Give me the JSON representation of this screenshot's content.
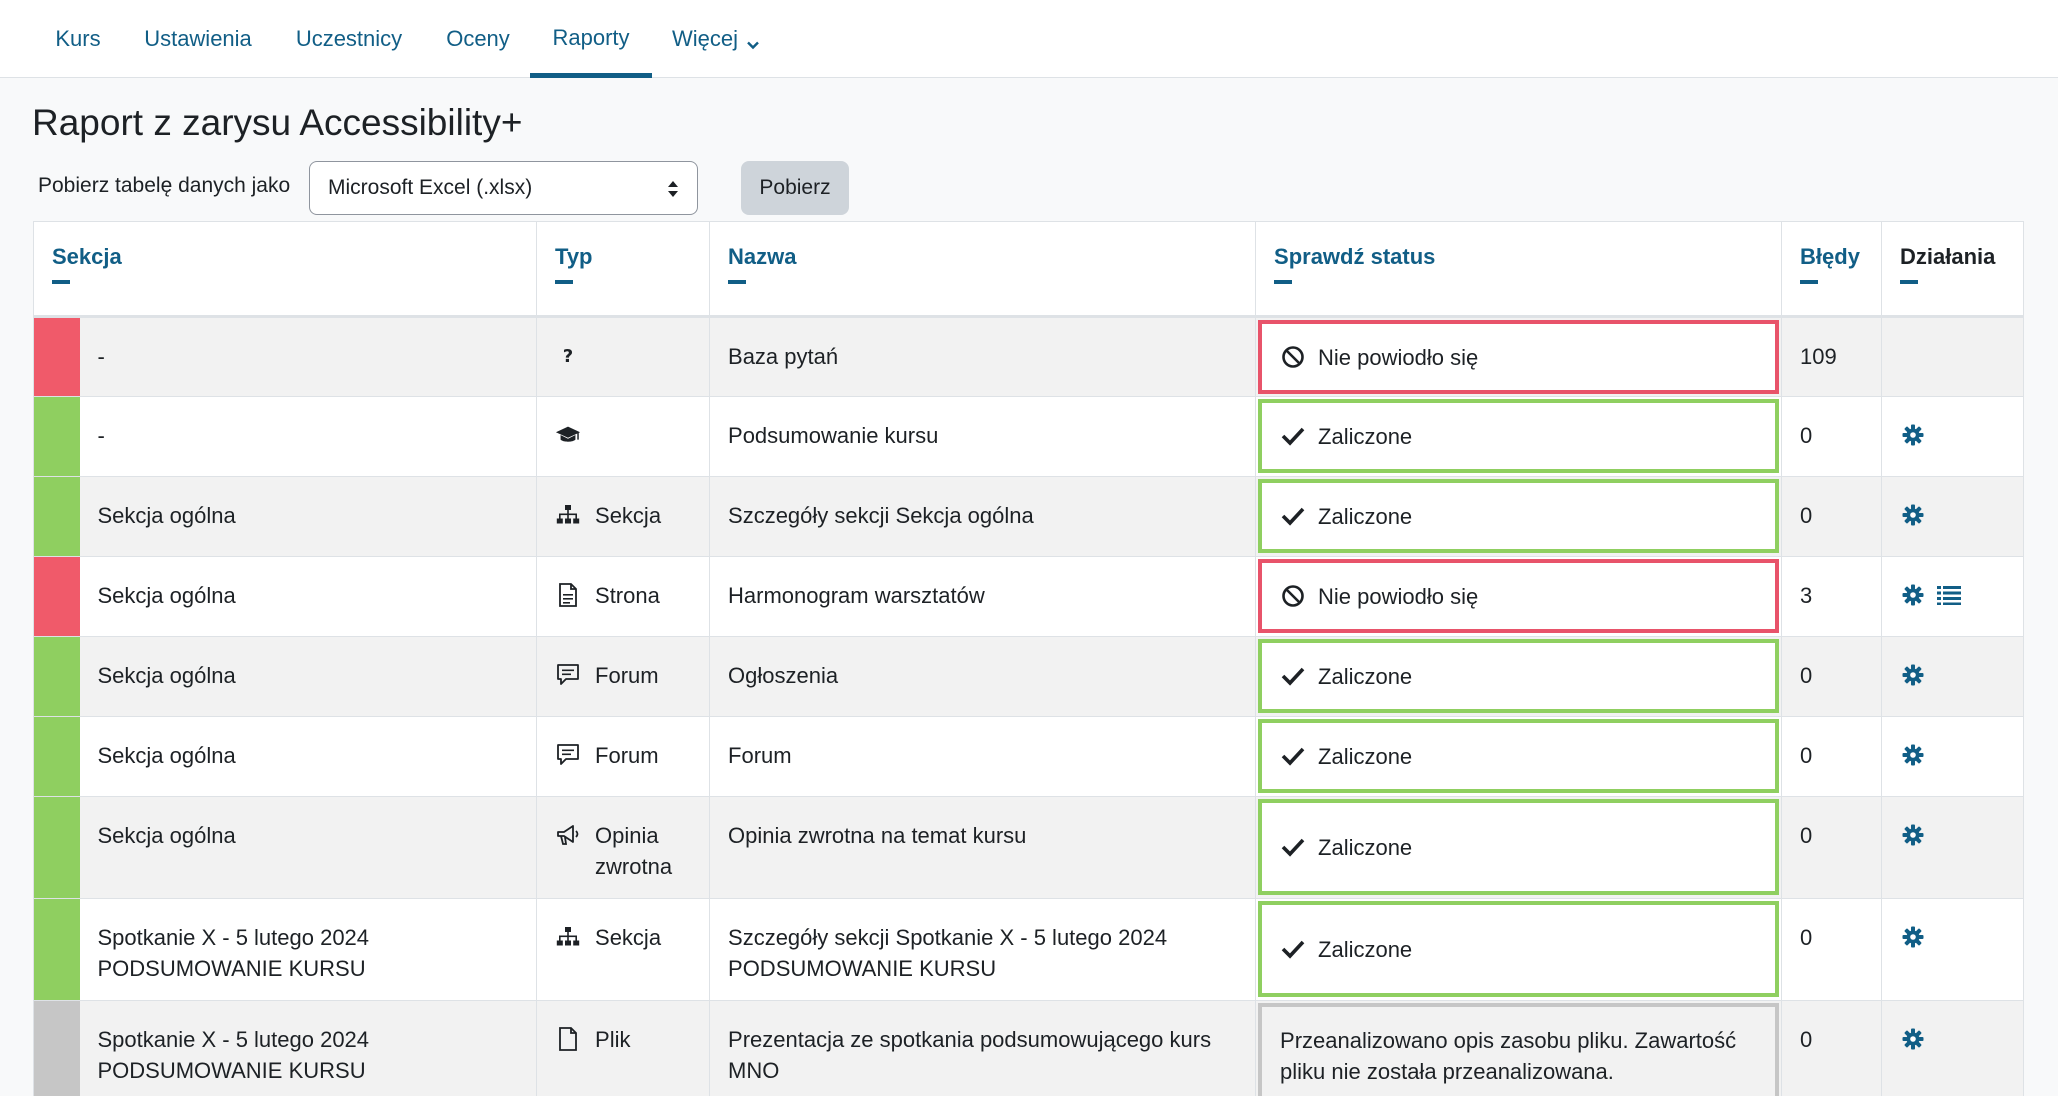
{
  "nav": {
    "tabs": [
      {
        "label": "Kurs"
      },
      {
        "label": "Ustawienia"
      },
      {
        "label": "Uczestnicy"
      },
      {
        "label": "Oceny"
      },
      {
        "label": "Raporty"
      },
      {
        "label": "Więcej"
      }
    ],
    "active_tab": "Raporty"
  },
  "page": {
    "title": "Raport z zarysu Accessibility+"
  },
  "download": {
    "label": "Pobierz tabelę danych jako",
    "selected_format": "Microsoft Excel (.xlsx)",
    "button_label": "Pobierz"
  },
  "table": {
    "headers": {
      "section": "Sekcja",
      "type": "Typ",
      "name": "Nazwa",
      "status": "Sprawdź status",
      "errors": "Błędy",
      "actions": "Działania"
    },
    "rows": [
      {
        "indicator": "fail",
        "section": "-",
        "type_icon": "question-icon",
        "type": "",
        "name": "Baza pytań",
        "status": "Nie powiodło się",
        "status_kind": "fail",
        "errors": "109",
        "actions": []
      },
      {
        "indicator": "pass",
        "section": "-",
        "type_icon": "graduation-cap-icon",
        "type": "",
        "name": "Podsumowanie kursu",
        "status": "Zaliczone",
        "status_kind": "pass",
        "errors": "0",
        "actions": [
          "gear-icon"
        ]
      },
      {
        "indicator": "pass",
        "section": "Sekcja ogólna",
        "type_icon": "sitemap-icon",
        "type": "Sekcja",
        "name": "Szczegóły sekcji Sekcja ogólna",
        "status": "Zaliczone",
        "status_kind": "pass",
        "errors": "0",
        "actions": [
          "gear-icon"
        ]
      },
      {
        "indicator": "fail",
        "section": "Sekcja ogólna",
        "type_icon": "page-icon",
        "type": "Strona",
        "name": "Harmonogram warsztatów",
        "status": "Nie powiodło się",
        "status_kind": "fail",
        "errors": "3",
        "actions": [
          "gear-icon",
          "list-icon"
        ]
      },
      {
        "indicator": "pass",
        "section": "Sekcja ogólna",
        "type_icon": "forum-icon",
        "type": "Forum",
        "name": "Ogłoszenia",
        "status": "Zaliczone",
        "status_kind": "pass",
        "errors": "0",
        "actions": [
          "gear-icon"
        ]
      },
      {
        "indicator": "pass",
        "section": "Sekcja ogólna",
        "type_icon": "forum-icon",
        "type": "Forum",
        "name": "Forum",
        "status": "Zaliczone",
        "status_kind": "pass",
        "errors": "0",
        "actions": [
          "gear-icon"
        ]
      },
      {
        "indicator": "pass",
        "section": "Sekcja ogólna",
        "type_icon": "megaphone-icon",
        "type": "Opinia zwrotna",
        "name": "Opinia zwrotna na temat kursu",
        "status": "Zaliczone",
        "status_kind": "pass",
        "errors": "0",
        "actions": [
          "gear-icon"
        ]
      },
      {
        "indicator": "pass",
        "section": "Spotkanie X - 5 lutego 2024 PODSUMOWANIE KURSU",
        "type_icon": "sitemap-icon",
        "type": "Sekcja",
        "name": "Szczegóły sekcji Spotkanie X - 5 lutego 2024 PODSUMOWANIE KURSU",
        "status": "Zaliczone",
        "status_kind": "pass",
        "errors": "0",
        "actions": [
          "gear-icon"
        ]
      },
      {
        "indicator": "na",
        "section": "Spotkanie X - 5 lutego 2024 PODSUMOWANIE KURSU",
        "type_icon": "file-icon",
        "type": "Plik",
        "name": "Prezentacja ze spotkania podsumowującego kurs MNO",
        "status": "Przeanalizowano opis zasobu pliku. Zawartość pliku nie została przeanalizowana.",
        "status_kind": "na",
        "errors": "0",
        "actions": [
          "gear-icon"
        ]
      }
    ]
  },
  "colors": {
    "accent": "#115e86",
    "fail": "#e8536a",
    "pass": "#8fcf60",
    "neutral": "#c6c6c6"
  }
}
